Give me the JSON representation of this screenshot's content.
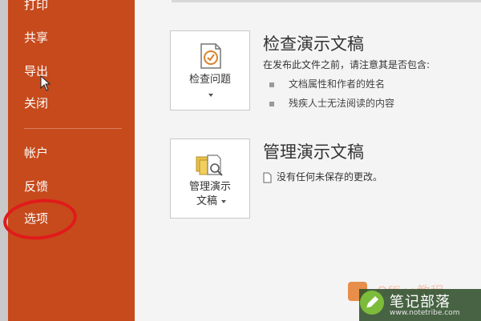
{
  "sidebar": {
    "items": [
      {
        "label": "打印"
      },
      {
        "label": "共享"
      },
      {
        "label": "导出"
      },
      {
        "label": "关闭"
      },
      {
        "label": "帐户"
      },
      {
        "label": "反馈"
      },
      {
        "label": "选项"
      }
    ],
    "highlight_color": "#e11a1a",
    "background_color": "#c64a1c"
  },
  "inspect": {
    "button_label": "检查问题",
    "title": "检查演示文稿",
    "description": "在发布此文件之前，请注意其是否包含:",
    "bullets": [
      "文档属性和作者的姓名",
      "残疾人士无法阅读的内容"
    ],
    "icon": "inspect-document-icon"
  },
  "manage": {
    "button_label_line1": "管理演示",
    "button_label_line2": "文稿",
    "title": "管理演示文稿",
    "status": "没有任何未保存的更改。",
    "icon": "manage-documents-icon"
  },
  "watermark": {
    "title": "笔记部落",
    "url": "www.notetribe.com",
    "faint_text": "Office教程"
  }
}
